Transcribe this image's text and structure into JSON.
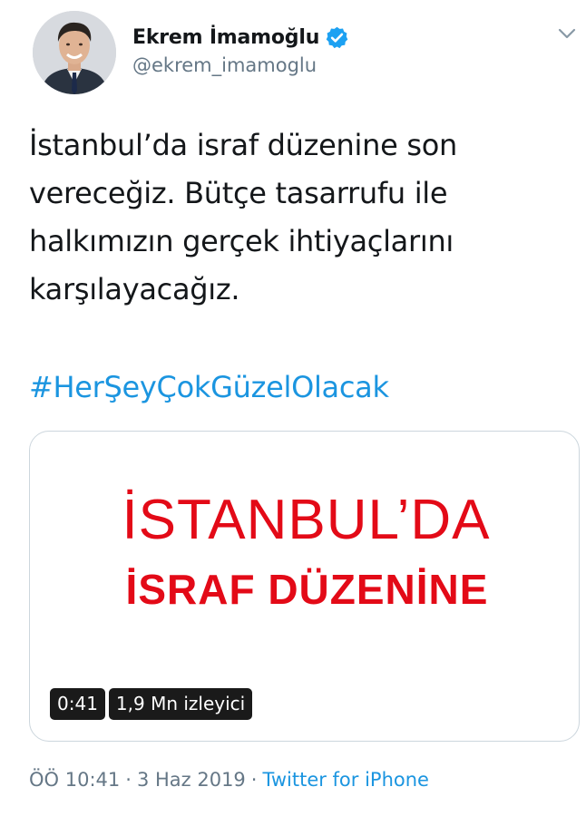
{
  "author": {
    "name": "Ekrem İmamoğlu",
    "handle": "@ekrem_imamoglu",
    "verified": true
  },
  "tweet": {
    "text": "İstanbul’da israf düzenine son vereceğiz. Bütçe tasarrufu ile halkımızın gerçek ihtiyaçlarını karşılayacağız.",
    "hashtag": "#HerŞeyÇokGüzelOlacak"
  },
  "media": {
    "title_line1": "İSTANBUL’DA",
    "title_line2": "İSRAF DÜZENİNE",
    "duration": "0:41",
    "views": "1,9 Mn izleyici"
  },
  "meta": {
    "time": "ÖÖ 10:41",
    "separator": "·",
    "date": "3 Haz 2019",
    "source": "Twitter for iPhone"
  },
  "colors": {
    "link": "#1b95e0",
    "secondary_text": "#657786",
    "brand_red": "#e30a17",
    "border": "#ccd6dd"
  },
  "icons": {
    "verified": "verified-badge-icon",
    "caret": "chevron-down-icon"
  }
}
